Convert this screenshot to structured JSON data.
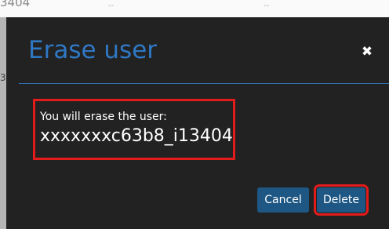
{
  "background": {
    "row_id": "3404",
    "cell_2": "--",
    "cell_3": "--",
    "side_text": "3"
  },
  "modal": {
    "title": "Erase user",
    "close_symbol": "✖",
    "message_label": "You will erase the user:",
    "username": "xxxxxxxc63b8_i13404",
    "cancel_label": "Cancel",
    "delete_label": "Delete"
  },
  "colors": {
    "modal_bg": "#222222",
    "title": "#2f78c4",
    "button": "#1e5784",
    "highlight": "#e31b1b"
  }
}
